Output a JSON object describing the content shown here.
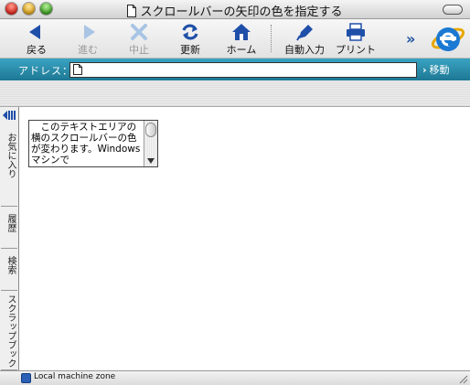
{
  "window": {
    "title": "スクロールバーの矢印の色を指定する"
  },
  "toolbar": {
    "buttons": [
      {
        "label": "戻る"
      },
      {
        "label": "進む"
      },
      {
        "label": "中止"
      },
      {
        "label": "更新"
      },
      {
        "label": "ホーム"
      },
      {
        "label": "自動入力"
      },
      {
        "label": "プリント"
      }
    ],
    "overflow": "»"
  },
  "address": {
    "label": "アドレス：",
    "value": "",
    "go_label": "移動",
    "go_arrow": "›"
  },
  "sidebar": {
    "tabs": [
      {
        "label": "お気に入り"
      },
      {
        "label": "履歴"
      },
      {
        "label": "検索"
      },
      {
        "label": "スクラップブック"
      }
    ]
  },
  "content": {
    "textarea_text": "　このテキストエリアの横のスクロールバーの色が変わります。Windowsマシンで"
  },
  "status": {
    "zone": "Local machine zone"
  },
  "colors": {
    "address_bar": "#2a8fae",
    "toolbar_icon": "#1f4fa8"
  }
}
